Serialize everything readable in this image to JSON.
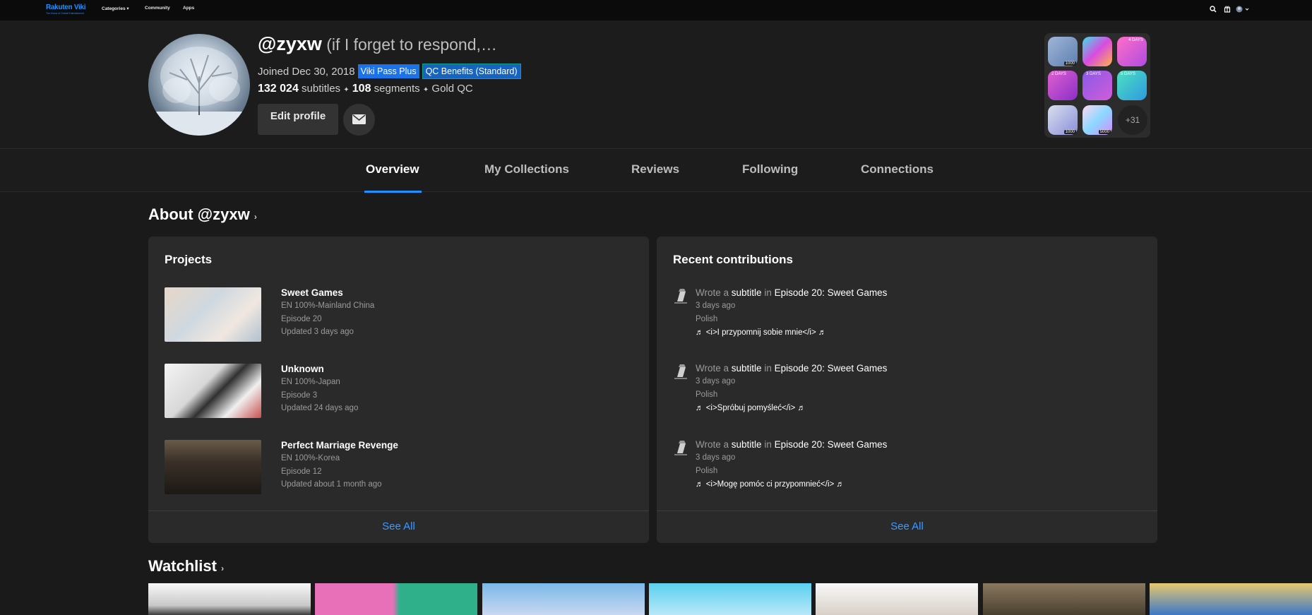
{
  "nav": {
    "logo_text": "Rakuten Viki",
    "logo_tagline": "The Home of Global Entertainment",
    "links": [
      "Categories ▾",
      "Community",
      "Apps"
    ]
  },
  "profile": {
    "username": "@zyxw",
    "bio": " (if I forget to respond,…",
    "joined": "Joined Dec 30, 2018",
    "badges": [
      "Viki Pass Plus",
      "QC Benefits (Standard)"
    ],
    "subtitles_count": "132 024",
    "subtitles_label": " subtitles ",
    "segments_count": "108",
    "segments_label": " segments ",
    "qc_label": " Gold QC",
    "separator": "✦",
    "edit_label": "Edit profile",
    "achievements": {
      "tile_labels": [
        "1000",
        "",
        "4 DAYS",
        "2 DAYS",
        "3 DAYS",
        "5 DAYS",
        "1000",
        "5000"
      ],
      "more": "+31"
    }
  },
  "tabs": [
    "Overview",
    "My Collections",
    "Reviews",
    "Following",
    "Connections"
  ],
  "about": {
    "title": "About @zyxw",
    "chevron": "›"
  },
  "projects": {
    "title": "Projects",
    "items": [
      {
        "title": "Sweet Games",
        "line1": "EN 100%-Mainland China",
        "line2": "Episode 20",
        "line3": "Updated 3 days ago"
      },
      {
        "title": "Unknown",
        "line1": "EN 100%-Japan",
        "line2": "Episode 3",
        "line3": "Updated 24 days ago"
      },
      {
        "title": "Perfect Marriage Revenge",
        "line1": "EN 100%-Korea",
        "line2": "Episode 12",
        "line3": "Updated about 1 month ago"
      }
    ],
    "see_all": "See All"
  },
  "contributions": {
    "title": "Recent contributions",
    "wrote": "Wrote a ",
    "kind": "subtitle",
    "in": " in ",
    "items": [
      {
        "episode": "Episode 20: Sweet Games",
        "time": "3 days ago",
        "lang": "Polish",
        "text": "♬ <i>I przypomnij sobie mnie</i> ♬"
      },
      {
        "episode": "Episode 20: Sweet Games",
        "time": "3 days ago",
        "lang": "Polish",
        "text": "♬ <i>Spróbuj pomyśleć</i> ♬"
      },
      {
        "episode": "Episode 20: Sweet Games",
        "time": "3 days ago",
        "lang": "Polish",
        "text": "♬ <i>Mogę pomóc ci przypomnieć</i> ♬"
      }
    ],
    "see_all": "See All"
  },
  "watchlist": {
    "title": "Watchlist",
    "chevron": "›"
  },
  "colors": {
    "accent": "#1e90ff",
    "link": "#3d9bff",
    "badge_pass": "#1a73e8",
    "badge_qc": "#1565c0"
  }
}
